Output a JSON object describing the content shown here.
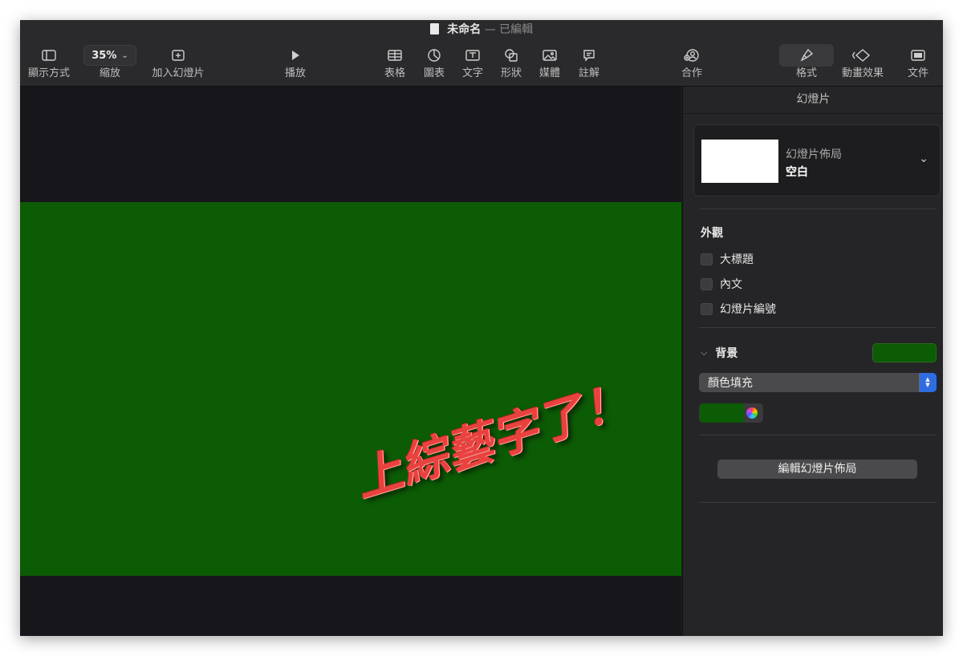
{
  "window": {
    "title": "未命名",
    "separator": "—",
    "status": "已編輯"
  },
  "toolbar": {
    "view_label": "顯示方式",
    "zoom_value": "35%",
    "zoom_label": "縮放",
    "add_slide_label": "加入幻燈片",
    "play_label": "播放",
    "table_label": "表格",
    "chart_label": "圖表",
    "text_label": "文字",
    "shape_label": "形狀",
    "media_label": "媒體",
    "comment_label": "註解",
    "collaborate_label": "合作",
    "format_label": "格式",
    "animate_label": "動畫效果",
    "document_label": "文件"
  },
  "slide": {
    "background_color": "#0c5b05",
    "wordart_text": "上綜藝字了！",
    "wordart_color": "#e8423f"
  },
  "panel": {
    "header": "幻燈片",
    "layout_label": "幻燈片佈局",
    "layout_value": "空白",
    "appearance_title": "外觀",
    "options": [
      {
        "label": "大標題",
        "checked": false
      },
      {
        "label": "內文",
        "checked": false
      },
      {
        "label": "幻燈片編號",
        "checked": false
      }
    ],
    "background_title": "背景",
    "fill_type": "顏色填充",
    "fill_color": "#0c5b05",
    "edit_layout_button": "編輯幻燈片佈局"
  }
}
